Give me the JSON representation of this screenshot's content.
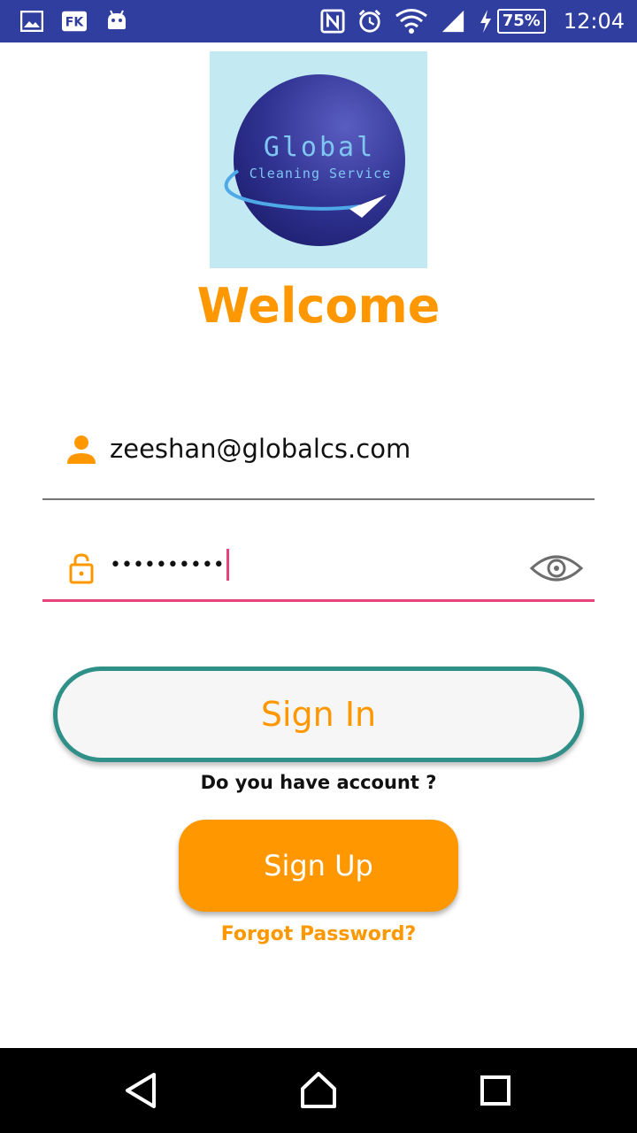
{
  "status_bar": {
    "battery": "75%",
    "time": "12:04",
    "icons": [
      "gallery-icon",
      "fk-icon",
      "android-icon",
      "nfc-icon",
      "alarm-icon",
      "wifi-icon",
      "signal-icon",
      "charging-icon"
    ]
  },
  "logo": {
    "line1": "Global",
    "line2": "Cleaning Service"
  },
  "welcome": "Welcome",
  "email": {
    "value": "zeeshan@globalcs.com"
  },
  "password": {
    "masked_value": "••••••••••"
  },
  "buttons": {
    "signin": "Sign In",
    "signup": "Sign Up"
  },
  "account_question": "Do you have account ?",
  "forgot_password": "Forgot Password?",
  "colors": {
    "status_bar": "#303F9F",
    "accent": "#FF9800",
    "signin_border": "#2E9088",
    "focus_underline": "#E8437B"
  },
  "nav_bar": {
    "icons": [
      "back-icon",
      "home-icon",
      "recents-icon"
    ]
  }
}
